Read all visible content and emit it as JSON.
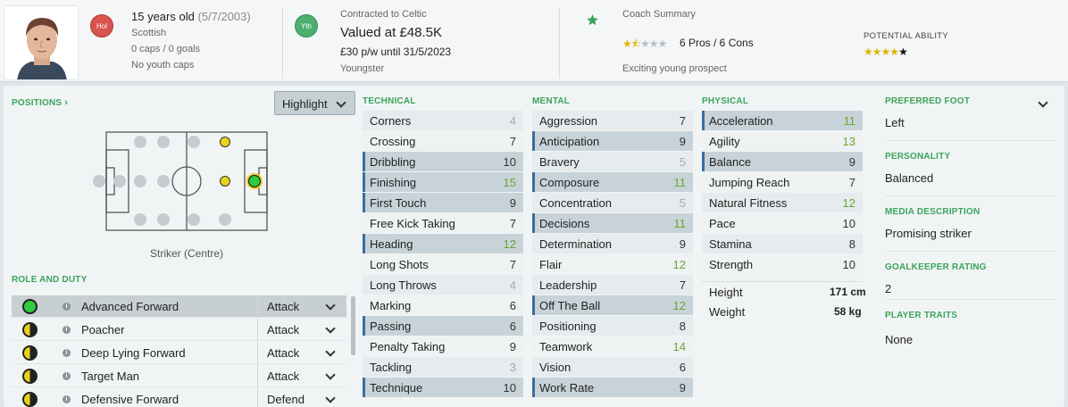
{
  "header": {
    "age_text": "15 years old",
    "dob": "(5/7/2003)",
    "nationality": "Scottish",
    "caps": "0 caps / 0 goals",
    "youth_caps": "No youth caps",
    "nation_badge": "Hol",
    "club_badge": "Yth",
    "contract": "Contracted to Celtic",
    "value": "Valued at £48.5K",
    "wage": "£30 p/w until 31/5/2023",
    "squad_status": "Youngster",
    "coach_title": "Coach Summary",
    "coach_pros_cons": "6 Pros / 6 Cons",
    "coach_stars": 2.5,
    "coach_comment": "Exciting young prospect",
    "potential_title": "POTENTIAL ABILITY",
    "potential_stars": 4.5
  },
  "positions": {
    "title": "POSITIONS",
    "highlight_label": "Highlight",
    "position_label": "Striker (Centre)"
  },
  "roles": {
    "title": "ROLE AND DUTY",
    "items": [
      {
        "name": "Advanced Forward",
        "duty": "Attack",
        "rating": "full"
      },
      {
        "name": "Poacher",
        "duty": "Attack",
        "rating": "half"
      },
      {
        "name": "Deep Lying Forward",
        "duty": "Attack",
        "rating": "half"
      },
      {
        "name": "Target Man",
        "duty": "Attack",
        "rating": "half"
      },
      {
        "name": "Defensive Forward",
        "duty": "Defend",
        "rating": "half"
      }
    ]
  },
  "technical": {
    "title": "TECHNICAL",
    "items": [
      {
        "name": "Corners",
        "value": "4",
        "hl": false
      },
      {
        "name": "Crossing",
        "value": "7",
        "hl": false
      },
      {
        "name": "Dribbling",
        "value": "10",
        "hl": true
      },
      {
        "name": "Finishing",
        "value": "15",
        "hl": true
      },
      {
        "name": "First Touch",
        "value": "9",
        "hl": true
      },
      {
        "name": "Free Kick Taking",
        "value": "7",
        "hl": false
      },
      {
        "name": "Heading",
        "value": "12",
        "hl": true
      },
      {
        "name": "Long Shots",
        "value": "7",
        "hl": false
      },
      {
        "name": "Long Throws",
        "value": "4",
        "hl": false
      },
      {
        "name": "Marking",
        "value": "6",
        "hl": false
      },
      {
        "name": "Passing",
        "value": "6",
        "hl": true
      },
      {
        "name": "Penalty Taking",
        "value": "9",
        "hl": false
      },
      {
        "name": "Tackling",
        "value": "3",
        "hl": false
      },
      {
        "name": "Technique",
        "value": "10",
        "hl": true
      }
    ]
  },
  "mental": {
    "title": "MENTAL",
    "items": [
      {
        "name": "Aggression",
        "value": "7",
        "hl": false
      },
      {
        "name": "Anticipation",
        "value": "9",
        "hl": true
      },
      {
        "name": "Bravery",
        "value": "5",
        "hl": false
      },
      {
        "name": "Composure",
        "value": "11",
        "hl": true
      },
      {
        "name": "Concentration",
        "value": "5",
        "hl": false
      },
      {
        "name": "Decisions",
        "value": "11",
        "hl": true
      },
      {
        "name": "Determination",
        "value": "9",
        "hl": false
      },
      {
        "name": "Flair",
        "value": "12",
        "hl": false
      },
      {
        "name": "Leadership",
        "value": "7",
        "hl": false
      },
      {
        "name": "Off The Ball",
        "value": "12",
        "hl": true
      },
      {
        "name": "Positioning",
        "value": "8",
        "hl": false
      },
      {
        "name": "Teamwork",
        "value": "14",
        "hl": false
      },
      {
        "name": "Vision",
        "value": "6",
        "hl": false
      },
      {
        "name": "Work Rate",
        "value": "9",
        "hl": true
      }
    ]
  },
  "physical": {
    "title": "PHYSICAL",
    "items": [
      {
        "name": "Acceleration",
        "value": "11",
        "hl": true
      },
      {
        "name": "Agility",
        "value": "13",
        "hl": false
      },
      {
        "name": "Balance",
        "value": "9",
        "hl": true
      },
      {
        "name": "Jumping Reach",
        "value": "7",
        "hl": false
      },
      {
        "name": "Natural Fitness",
        "value": "12",
        "hl": false
      },
      {
        "name": "Pace",
        "value": "10",
        "hl": false
      },
      {
        "name": "Stamina",
        "value": "8",
        "hl": false
      },
      {
        "name": "Strength",
        "value": "10",
        "hl": false
      }
    ],
    "height_label": "Height",
    "height_value": "171 cm",
    "weight_label": "Weight",
    "weight_value": "58 kg"
  },
  "info": {
    "preferred_foot_title": "PREFERRED FOOT",
    "preferred_foot": "Left",
    "personality_title": "PERSONALITY",
    "personality": "Balanced",
    "media_title": "MEDIA DESCRIPTION",
    "media": "Promising striker",
    "gk_title": "GOALKEEPER RATING",
    "gk": "2",
    "traits_title": "PLAYER TRAITS",
    "traits": "None"
  },
  "colors": {
    "accent_green": "#3aa55a",
    "highlight_blue": "#3a6f9e",
    "value_high": "#6aa52e",
    "value_low": "#aaaaaa",
    "nation_badge": "#d9534f",
    "club_badge": "#4caf6e"
  }
}
